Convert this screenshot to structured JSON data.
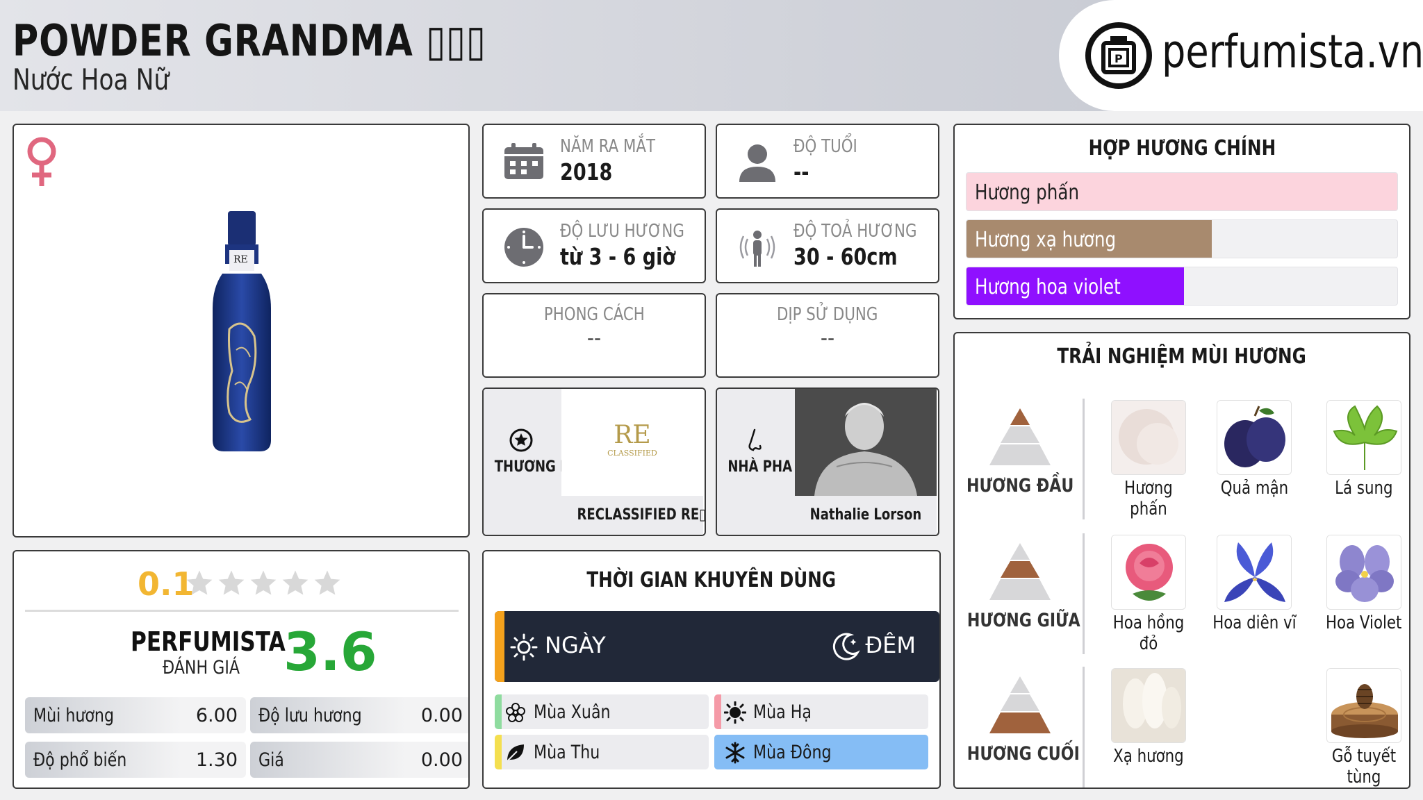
{
  "header": {
    "title": "POWDER GRANDMA ▯▯▯",
    "subtitle": "Nước Hoa Nữ",
    "logo_text": "perfumista.vn"
  },
  "product": {
    "gender_icon": "female-symbol-icon",
    "image_icon": "perfume-bottle",
    "bottle_label": "RE"
  },
  "rating": {
    "user_score": "0.1",
    "star_count": 5,
    "star_fill": 0.02,
    "perfumista_label": "PERFUMISTA",
    "perfumista_sub": "ĐÁNH GIÁ",
    "perfumista_score": "3.6",
    "metrics": [
      {
        "label": "Mùi hương",
        "value": "6.00"
      },
      {
        "label": "Độ lưu hương",
        "value": "0.00"
      },
      {
        "label": "Độ phổ biến",
        "value": "1.30"
      },
      {
        "label": "Giá",
        "value": "0.00"
      }
    ]
  },
  "info": {
    "release": {
      "label": "NĂM RA MẮT",
      "value": "2018",
      "icon": "calendar-icon"
    },
    "age": {
      "label": "ĐỘ TUỔI",
      "value": "--",
      "icon": "person-icon"
    },
    "longevity": {
      "label": "ĐỘ LƯU HƯƠNG",
      "value": "từ 3 - 6 giờ",
      "icon": "clock-icon"
    },
    "sillage": {
      "label": "ĐỘ TOẢ HƯƠNG",
      "value": "30 - 60cm",
      "icon": "sillage-icon"
    },
    "style": {
      "label": "PHONG CÁCH",
      "value": "--"
    },
    "occasion": {
      "label": "DỊP SỬ DỤNG",
      "value": "--"
    }
  },
  "brand": {
    "label": "THƯƠNG HIỆU",
    "name": "RECLASSIFIED RE▯▯▯",
    "logo_text": "RE",
    "logo_sub": "CLASSIFIED"
  },
  "perfumer": {
    "label": "NHÀ PHA CHẾ",
    "name": "Nathalie Lorson"
  },
  "time": {
    "title": "THỜI GIAN KHUYÊN DÙNG",
    "day": "NGÀY",
    "night": "ĐÊM",
    "seasons": [
      {
        "label": "Mùa Xuân",
        "icon": "flower-icon",
        "strip": "#8fdc9f",
        "bg": "#ececef"
      },
      {
        "label": "Mùa Hạ",
        "icon": "sun-icon",
        "strip": "#f59aa7",
        "bg": "#ececef"
      },
      {
        "label": "Mùa Thu",
        "icon": "leaf-icon",
        "strip": "#f4df4f",
        "bg": "#ececef"
      },
      {
        "label": "Mùa Đông",
        "icon": "snowflake-icon",
        "strip": "#85bdf5",
        "bg": "#85bdf5"
      }
    ]
  },
  "accords": {
    "title": "HỢP HƯƠNG CHÍNH",
    "items": [
      {
        "label": "Hương phấn",
        "fill": 1.0,
        "color": "#fcd4dd",
        "text_color": "#222222"
      },
      {
        "label": "Hương xạ hương",
        "fill": 0.57,
        "color": "#a88a6e",
        "text_color": "#ffffff"
      },
      {
        "label": "Hương hoa violet",
        "fill": 0.505,
        "color": "#8f10ff",
        "text_color": "#ffffff"
      }
    ]
  },
  "experience": {
    "title": "TRẢI NGHIỆM MÙI HƯƠNG",
    "tiers": [
      {
        "label": "HƯƠNG ĐẦU",
        "notes": [
          {
            "label": "Hương phấn",
            "icon": "powder-image"
          },
          {
            "label": "Quả mận",
            "icon": "plum-image"
          },
          {
            "label": "Lá sung",
            "icon": "fig-leaf-image"
          }
        ]
      },
      {
        "label": "HƯƠNG GIỮA",
        "notes": [
          {
            "label": "Hoa hồng đỏ",
            "icon": "red-rose-image"
          },
          {
            "label": "Hoa diên vĩ",
            "icon": "iris-image"
          },
          {
            "label": "Hoa Violet",
            "icon": "violet-image"
          }
        ]
      },
      {
        "label": "HƯƠNG CUỐI",
        "notes": [
          {
            "label": "Xạ hương",
            "icon": "musk-image"
          },
          null,
          {
            "label": "Gỗ tuyết tùng",
            "icon": "cedar-image"
          }
        ]
      }
    ]
  }
}
